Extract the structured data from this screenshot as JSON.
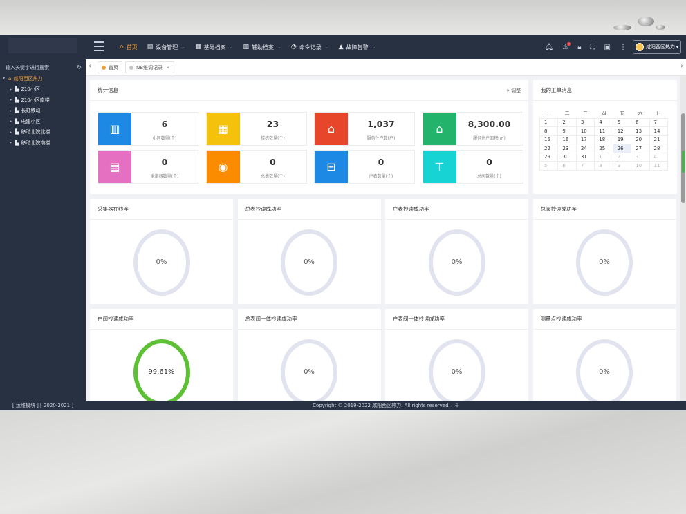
{
  "topbar": {
    "menu": [
      {
        "label": "首页",
        "icon": "home-icon",
        "active": true
      },
      {
        "label": "设备管理",
        "icon": "device-icon",
        "dropdown": true
      },
      {
        "label": "基础档案",
        "icon": "archive-icon",
        "dropdown": true
      },
      {
        "label": "辅助档案",
        "icon": "document-icon",
        "dropdown": true
      },
      {
        "label": "命令记录",
        "icon": "command-icon",
        "dropdown": true
      },
      {
        "label": "故障告警",
        "icon": "warning-icon",
        "dropdown": true
      }
    ],
    "user_label": "咸阳西区热力"
  },
  "sidebar": {
    "search_placeholder": "输入关键字进行搜索",
    "root": "咸阳西区热力",
    "items": [
      "210小区",
      "210小区南楼",
      "长虹移动",
      "电建小区",
      "移动北院北楼",
      "移动北院南楼"
    ],
    "footer": "[ 运维模块 ] [ 2020-2021 ]"
  },
  "tabs": [
    {
      "label": "首页",
      "dot_color": "#f0a03a"
    },
    {
      "label": "NB维调记录",
      "dot_color": "#c8c8c8",
      "closable": true
    }
  ],
  "stats": {
    "title": "统计信息",
    "adjust_label": "调整",
    "items": [
      {
        "value": "6",
        "label": "小区数量(个)",
        "color": "#1e88e5",
        "icon": "building-icon"
      },
      {
        "value": "23",
        "label": "楼栋数量(个)",
        "color": "#f4c20d",
        "icon": "apartment-icon"
      },
      {
        "value": "1,037",
        "label": "服务住户数(户)",
        "color": "#e8462b",
        "icon": "house-user-icon"
      },
      {
        "value": "8,300.00",
        "label": "服务住户面积(㎡)",
        "color": "#23b36b",
        "icon": "house-area-icon"
      },
      {
        "value": "0",
        "label": "采集器数量(个)",
        "color": "#e56fc1",
        "icon": "collector-icon"
      },
      {
        "value": "0",
        "label": "总表数量(个)",
        "color": "#fb8c00",
        "icon": "meter-icon"
      },
      {
        "value": "0",
        "label": "户表数量(个)",
        "color": "#1e88e5",
        "icon": "household-meter-icon"
      },
      {
        "value": "0",
        "label": "总阀数量(个)",
        "color": "#18d3d3",
        "icon": "valve-icon"
      }
    ]
  },
  "calendar": {
    "title": "我的工单消息",
    "weekdays": [
      "一",
      "二",
      "三",
      "四",
      "五",
      "六",
      "日"
    ],
    "weeks": [
      [
        "1",
        "2",
        "3",
        "4",
        "5",
        "6",
        "7"
      ],
      [
        "8",
        "9",
        "10",
        "11",
        "12",
        "13",
        "14"
      ],
      [
        "15",
        "16",
        "17",
        "18",
        "19",
        "20",
        "21"
      ],
      [
        "22",
        "23",
        "24",
        "25",
        "26",
        "27",
        "28"
      ],
      [
        "29",
        "30",
        "31",
        "1",
        "2",
        "3",
        "4"
      ],
      [
        "5",
        "6",
        "7",
        "8",
        "9",
        "10",
        "11"
      ]
    ]
  },
  "gauges": [
    {
      "title": "采集器在线率",
      "value": "0%"
    },
    {
      "title": "总表抄读成功率",
      "value": "0%"
    },
    {
      "title": "户表抄读成功率",
      "value": "0%"
    },
    {
      "title": "总阀抄读成功率",
      "value": "0%"
    },
    {
      "title": "户阀抄读成功率",
      "value": "99.61%"
    },
    {
      "title": "总表阀一体抄读成功率",
      "value": "0%"
    },
    {
      "title": "户表阀一体抄读成功率",
      "value": "0%"
    },
    {
      "title": "测量点抄读成功率",
      "value": "0%"
    }
  ],
  "footer": {
    "copyright": "Copyright © 2019-2022 咸阳西区热力. All rights reserved."
  }
}
